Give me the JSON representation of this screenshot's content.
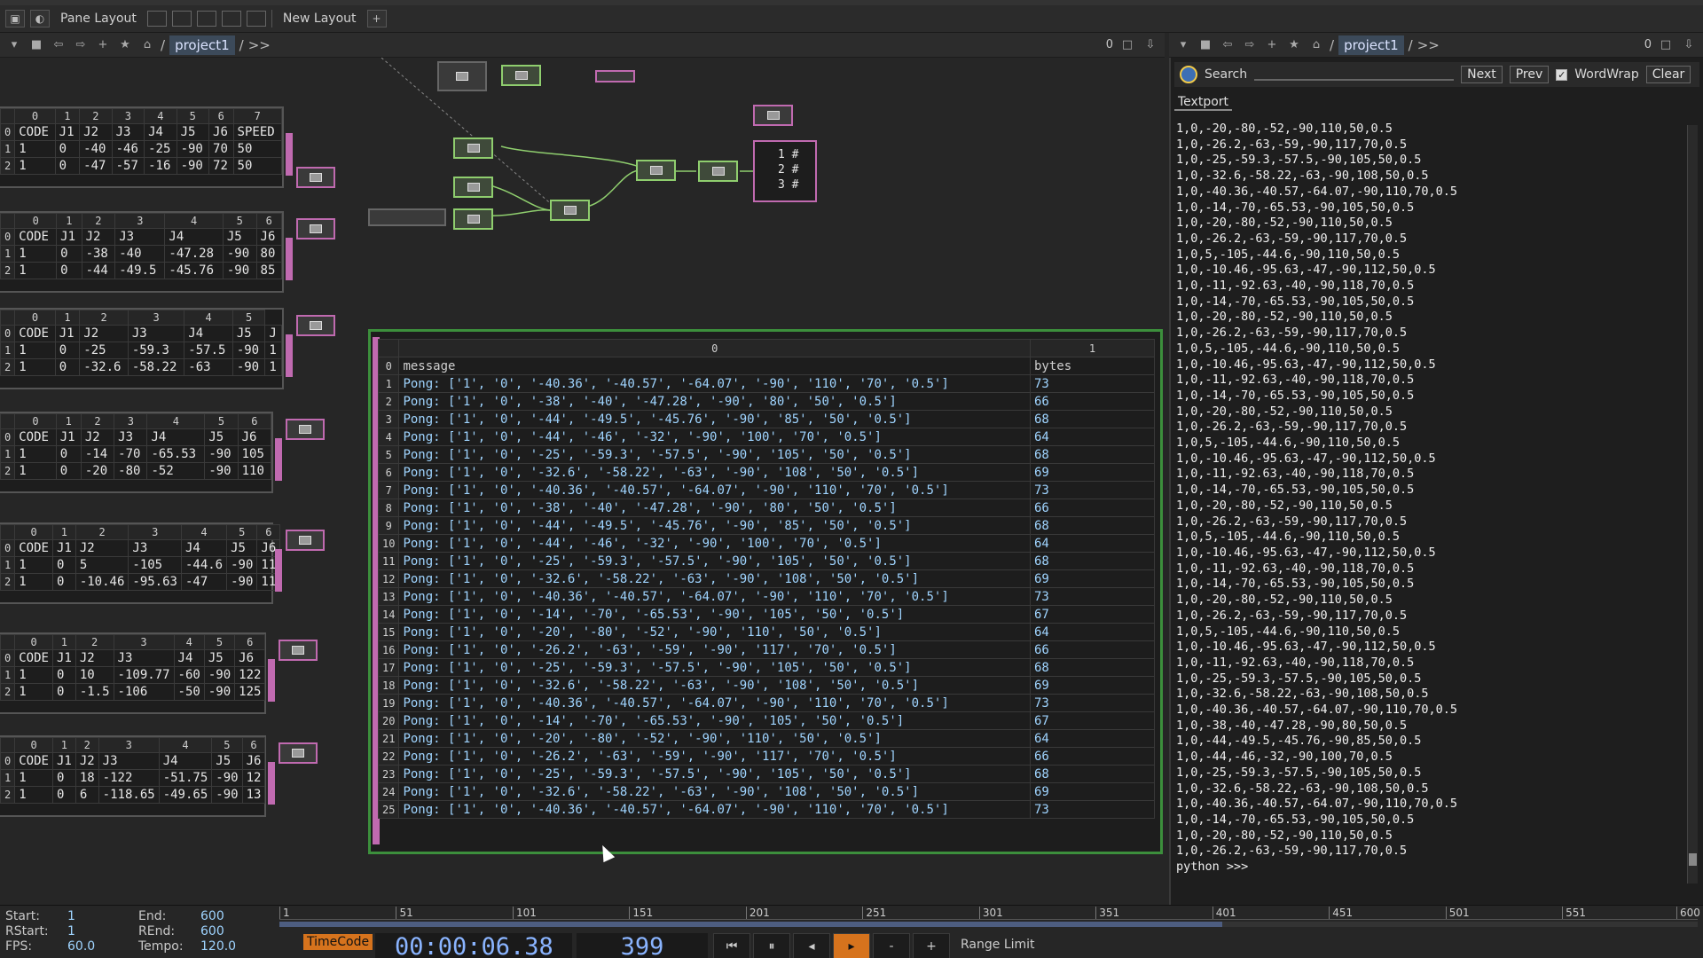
{
  "toolbar": {
    "pane_layout": "Pane Layout",
    "new_layout": "New Layout",
    "add": "+"
  },
  "left_nav": {
    "path": "project1",
    "sep": "/",
    "more": ">>",
    "count": "0"
  },
  "right_nav": {
    "path": "project1",
    "sep": "/",
    "more": ">>",
    "count": "0"
  },
  "dat_tables": [
    {
      "header": [
        "0",
        "1",
        "2",
        "3",
        "4",
        "5",
        "6",
        "7"
      ],
      "rows": [
        [
          "0",
          "CODE",
          "J1",
          "J2",
          "J3",
          "J4",
          "J5",
          "J6",
          "SPEED"
        ],
        [
          "1",
          "1",
          "0",
          "-40",
          "-46",
          "-25",
          "-90",
          "70",
          "50"
        ],
        [
          "2",
          "1",
          "0",
          "-47",
          "-57",
          "-16",
          "-90",
          "72",
          "50"
        ]
      ]
    },
    {
      "header": [
        "0",
        "1",
        "2",
        "3",
        "4",
        "5",
        "6"
      ],
      "rows": [
        [
          "0",
          "CODE",
          "J1",
          "J2",
          "J3",
          "J4",
          "J5",
          "J6"
        ],
        [
          "1",
          "1",
          "0",
          "-38",
          "-40",
          "-47.28",
          "-90",
          "80"
        ],
        [
          "2",
          "1",
          "0",
          "-44",
          "-49.5",
          "-45.76",
          "-90",
          "85"
        ]
      ]
    },
    {
      "header": [
        "0",
        "1",
        "2",
        "3",
        "4",
        "5"
      ],
      "rows": [
        [
          "0",
          "CODE",
          "J1",
          "J2",
          "J3",
          "J4",
          "J5",
          "J"
        ],
        [
          "1",
          "1",
          "0",
          "-25",
          "-59.3",
          "-57.5",
          "-90",
          "1"
        ],
        [
          "2",
          "1",
          "0",
          "-32.6",
          "-58.22",
          "-63",
          "-90",
          "1"
        ]
      ]
    },
    {
      "header": [
        "0",
        "1",
        "2",
        "3",
        "4",
        "5",
        "6"
      ],
      "rows": [
        [
          "0",
          "CODE",
          "J1",
          "J2",
          "J3",
          "J4",
          "J5",
          "J6"
        ],
        [
          "1",
          "1",
          "0",
          "-14",
          "-70",
          "-65.53",
          "-90",
          "105"
        ],
        [
          "2",
          "1",
          "0",
          "-20",
          "-80",
          "-52",
          "-90",
          "110"
        ]
      ]
    },
    {
      "header": [
        "0",
        "1",
        "2",
        "3",
        "4",
        "5",
        "6"
      ],
      "rows": [
        [
          "0",
          "CODE",
          "J1",
          "J2",
          "J3",
          "J4",
          "J5",
          "J6"
        ],
        [
          "1",
          "1",
          "0",
          "5",
          "-105",
          "-44.6",
          "-90",
          "11"
        ],
        [
          "2",
          "1",
          "0",
          "-10.46",
          "-95.63",
          "-47",
          "-90",
          "11"
        ]
      ]
    },
    {
      "header": [
        "0",
        "1",
        "2",
        "3",
        "4",
        "5",
        "6"
      ],
      "rows": [
        [
          "0",
          "CODE",
          "J1",
          "J2",
          "J3",
          "J4",
          "J5",
          "J6"
        ],
        [
          "1",
          "1",
          "0",
          "10",
          "-109.77",
          "-60",
          "-90",
          "122"
        ],
        [
          "2",
          "1",
          "0",
          "-1.5",
          "-106",
          "-50",
          "-90",
          "125"
        ]
      ]
    },
    {
      "header": [
        "0",
        "1",
        "2",
        "3",
        "4",
        "5",
        "6"
      ],
      "rows": [
        [
          "0",
          "CODE",
          "J1",
          "J2",
          "J3",
          "J4",
          "J5",
          "J6"
        ],
        [
          "1",
          "1",
          "0",
          "18",
          "-122",
          "-51.75",
          "-90",
          "12"
        ],
        [
          "2",
          "1",
          "0",
          "6",
          "-118.65",
          "-49.65",
          "-90",
          "13"
        ]
      ]
    }
  ],
  "mini_dat": {
    "rows": [
      "1 #",
      "2 #",
      "3 #"
    ]
  },
  "main_table": {
    "col_headers": [
      "0",
      "1"
    ],
    "fields": [
      "message",
      "bytes"
    ],
    "rows": [
      [
        "1",
        "Pong: ['1', '0', '-40.36', '-40.57', '-64.07', '-90', '110', '70', '0.5']",
        "73"
      ],
      [
        "2",
        "Pong: ['1', '0', '-38', '-40', '-47.28', '-90', '80', '50', '0.5']",
        "66"
      ],
      [
        "3",
        "Pong: ['1', '0', '-44', '-49.5', '-45.76', '-90', '85', '50', '0.5']",
        "68"
      ],
      [
        "4",
        "Pong: ['1', '0', '-44', '-46', '-32', '-90', '100', '70', '0.5']",
        "64"
      ],
      [
        "5",
        "Pong: ['1', '0', '-25', '-59.3', '-57.5', '-90', '105', '50', '0.5']",
        "68"
      ],
      [
        "6",
        "Pong: ['1', '0', '-32.6', '-58.22', '-63', '-90', '108', '50', '0.5']",
        "69"
      ],
      [
        "7",
        "Pong: ['1', '0', '-40.36', '-40.57', '-64.07', '-90', '110', '70', '0.5']",
        "73"
      ],
      [
        "8",
        "Pong: ['1', '0', '-38', '-40', '-47.28', '-90', '80', '50', '0.5']",
        "66"
      ],
      [
        "9",
        "Pong: ['1', '0', '-44', '-49.5', '-45.76', '-90', '85', '50', '0.5']",
        "68"
      ],
      [
        "10",
        "Pong: ['1', '0', '-44', '-46', '-32', '-90', '100', '70', '0.5']",
        "64"
      ],
      [
        "11",
        "Pong: ['1', '0', '-25', '-59.3', '-57.5', '-90', '105', '50', '0.5']",
        "68"
      ],
      [
        "12",
        "Pong: ['1', '0', '-32.6', '-58.22', '-63', '-90', '108', '50', '0.5']",
        "69"
      ],
      [
        "13",
        "Pong: ['1', '0', '-40.36', '-40.57', '-64.07', '-90', '110', '70', '0.5']",
        "73"
      ],
      [
        "14",
        "Pong: ['1', '0', '-14', '-70', '-65.53', '-90', '105', '50', '0.5']",
        "67"
      ],
      [
        "15",
        "Pong: ['1', '0', '-20', '-80', '-52', '-90', '110', '50', '0.5']",
        "64"
      ],
      [
        "16",
        "Pong: ['1', '0', '-26.2', '-63', '-59', '-90', '117', '70', '0.5']",
        "66"
      ],
      [
        "17",
        "Pong: ['1', '0', '-25', '-59.3', '-57.5', '-90', '105', '50', '0.5']",
        "68"
      ],
      [
        "18",
        "Pong: ['1', '0', '-32.6', '-58.22', '-63', '-90', '108', '50', '0.5']",
        "69"
      ],
      [
        "19",
        "Pong: ['1', '0', '-40.36', '-40.57', '-64.07', '-90', '110', '70', '0.5']",
        "73"
      ],
      [
        "20",
        "Pong: ['1', '0', '-14', '-70', '-65.53', '-90', '105', '50', '0.5']",
        "67"
      ],
      [
        "21",
        "Pong: ['1', '0', '-20', '-80', '-52', '-90', '110', '50', '0.5']",
        "64"
      ],
      [
        "22",
        "Pong: ['1', '0', '-26.2', '-63', '-59', '-90', '117', '70', '0.5']",
        "66"
      ],
      [
        "23",
        "Pong: ['1', '0', '-25', '-59.3', '-57.5', '-90', '105', '50', '0.5']",
        "68"
      ],
      [
        "24",
        "Pong: ['1', '0', '-32.6', '-58.22', '-63', '-90', '108', '50', '0.5']",
        "69"
      ],
      [
        "25",
        "Pong: ['1', '0', '-40.36', '-40.57', '-64.07', '-90', '110', '70', '0.5']",
        "73"
      ]
    ]
  },
  "textport": {
    "search_label": "Search",
    "next": "Next",
    "prev": "Prev",
    "wordwrap": "WordWrap",
    "clear": "Clear",
    "tab": "Textport",
    "lines": [
      "1,0,-20,-80,-52,-90,110,50,0.5",
      "1,0,-26.2,-63,-59,-90,117,70,0.5",
      "1,0,-25,-59.3,-57.5,-90,105,50,0.5",
      "1,0,-32.6,-58.22,-63,-90,108,50,0.5",
      "1,0,-40.36,-40.57,-64.07,-90,110,70,0.5",
      "1,0,-14,-70,-65.53,-90,105,50,0.5",
      "1,0,-20,-80,-52,-90,110,50,0.5",
      "1,0,-26.2,-63,-59,-90,117,70,0.5",
      "1,0,5,-105,-44.6,-90,110,50,0.5",
      "1,0,-10.46,-95.63,-47,-90,112,50,0.5",
      "1,0,-11,-92.63,-40,-90,118,70,0.5",
      "1,0,-14,-70,-65.53,-90,105,50,0.5",
      "1,0,-20,-80,-52,-90,110,50,0.5",
      "1,0,-26.2,-63,-59,-90,117,70,0.5",
      "1,0,5,-105,-44.6,-90,110,50,0.5",
      "1,0,-10.46,-95.63,-47,-90,112,50,0.5",
      "1,0,-11,-92.63,-40,-90,118,70,0.5",
      "1,0,-14,-70,-65.53,-90,105,50,0.5",
      "1,0,-20,-80,-52,-90,110,50,0.5",
      "1,0,-26.2,-63,-59,-90,117,70,0.5",
      "1,0,5,-105,-44.6,-90,110,50,0.5",
      "1,0,-10.46,-95.63,-47,-90,112,50,0.5",
      "1,0,-11,-92.63,-40,-90,118,70,0.5",
      "1,0,-14,-70,-65.53,-90,105,50,0.5",
      "1,0,-20,-80,-52,-90,110,50,0.5",
      "1,0,-26.2,-63,-59,-90,117,70,0.5",
      "1,0,5,-105,-44.6,-90,110,50,0.5",
      "1,0,-10.46,-95.63,-47,-90,112,50,0.5",
      "1,0,-11,-92.63,-40,-90,118,70,0.5",
      "1,0,-14,-70,-65.53,-90,105,50,0.5",
      "1,0,-20,-80,-52,-90,110,50,0.5",
      "1,0,-26.2,-63,-59,-90,117,70,0.5",
      "1,0,5,-105,-44.6,-90,110,50,0.5",
      "1,0,-10.46,-95.63,-47,-90,112,50,0.5",
      "1,0,-11,-92.63,-40,-90,118,70,0.5",
      "1,0,-25,-59.3,-57.5,-90,105,50,0.5",
      "1,0,-32.6,-58.22,-63,-90,108,50,0.5",
      "1,0,-40.36,-40.57,-64.07,-90,110,70,0.5",
      "1,0,-38,-40,-47.28,-90,80,50,0.5",
      "1,0,-44,-49.5,-45.76,-90,85,50,0.5",
      "1,0,-44,-46,-32,-90,100,70,0.5",
      "1,0,-25,-59.3,-57.5,-90,105,50,0.5",
      "1,0,-32.6,-58.22,-63,-90,108,50,0.5",
      "1,0,-40.36,-40.57,-64.07,-90,110,70,0.5",
      "1,0,-14,-70,-65.53,-90,105,50,0.5",
      "1,0,-20,-80,-52,-90,110,50,0.5",
      "1,0,-26.2,-63,-59,-90,117,70,0.5",
      "python >>>"
    ]
  },
  "timeline": {
    "start_label": "Start:",
    "start": "1",
    "end_label": "End:",
    "end": "600",
    "rstart_label": "RStart:",
    "rstart": "1",
    "rend_label": "REnd:",
    "rend": "600",
    "fps_label": "FPS:",
    "fps": "60.0",
    "tempo_label": "Tempo:",
    "tempo": "120.0",
    "ticks": [
      "1",
      "51",
      "101",
      "151",
      "201",
      "251",
      "301",
      "351",
      "401",
      "451",
      "501",
      "551",
      "600"
    ],
    "played_fraction": 0.665,
    "timecode_label": "TimeCode",
    "timecode": "00:00:06.38",
    "frame": "399",
    "range_limit": "Range Limit"
  },
  "colors": {
    "accent": "#3c8f3c",
    "node_green": "#8fce6e",
    "node_pink": "#c06ab0",
    "value_blue": "#9fd4ff",
    "timecode_orange": "#d6731d"
  }
}
